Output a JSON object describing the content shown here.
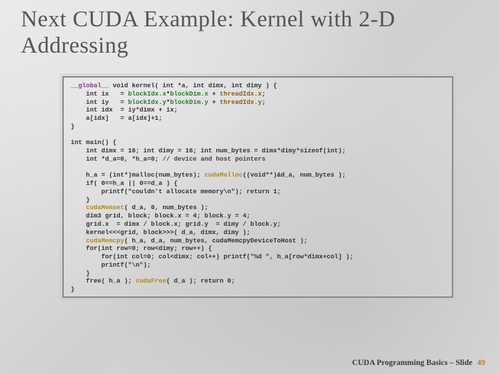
{
  "title": "Next CUDA Example: Kernel with 2-D Addressing",
  "code": {
    "kernel_sig_1": "__global__",
    "kernel_sig_2": " void kernel( int *a, int dimx, int dimy ) {",
    "ix_1": "    int ix   = ",
    "ix_b1": "blockIdx.x",
    "ix_2": "*",
    "ix_b2": "blockDim.x",
    "ix_3": " + ",
    "ix_t": "threadIdx.x",
    "ix_4": ";",
    "iy_1": "    int iy   = ",
    "iy_b1": "blockIdx.y",
    "iy_2": "*",
    "iy_b2": "blockDim.y",
    "iy_3": " + ",
    "iy_t": "threadIdx.y",
    "iy_4": ";",
    "idx": "    int idx  = iy*dimx + ix;",
    "assign": "    a[idx]   = a[idx]+1;",
    "kend": "}",
    "blank1": "",
    "main_sig": "int main() {",
    "m1": "    int dimx = 16; int dimy = 16; int num_bytes = dimx*dimy*sizeof(int);",
    "m2a": "    int *d_a=0, *h_a=0; ",
    "m2c": "// device and host pointers",
    "blank2": "",
    "m3a": "    h_a = (int*)malloc(num_bytes); ",
    "m3c": "cudaMalloc",
    "m3b": "((void**)&d_a, num_bytes );",
    "m4": "    if( 0==h_a || 0==d_a ) {",
    "m5": "        printf(\"couldn't allocate memory\\n\"); return 1;",
    "m6": "    }",
    "m7a": "    ",
    "m7c": "cudaMemset",
    "m7b": "( d_a, 0, num_bytes );",
    "m8": "    dim3 grid, block; block.x = 4; block.y = 4;",
    "m9": "    grid.x  = dimx / block.x; grid.y  = dimy / block.y;",
    "m10": "    kernel<<<grid, block>>>( d_a, dimx, dimy );",
    "m11a": "    ",
    "m11c": "cudaMemcpy",
    "m11b": "( h_a, d_a, num_bytes, cudaMemcpyDeviceToHost );",
    "m12": "    for(int row=0; row<dimy; row++) {",
    "m13": "        for(int col=0; col<dimx; col++) printf(\"%d \", h_a[row*dimx+col] );",
    "m14": "        printf(\"\\n\");",
    "m15": "    }",
    "m16a": "    free( h_a ); ",
    "m16c": "cudaFree",
    "m16b": "( d_a ); return 0;",
    "mend": "}"
  },
  "footer": {
    "text": "CUDA Programming Basics – Slide",
    "page": "49"
  }
}
